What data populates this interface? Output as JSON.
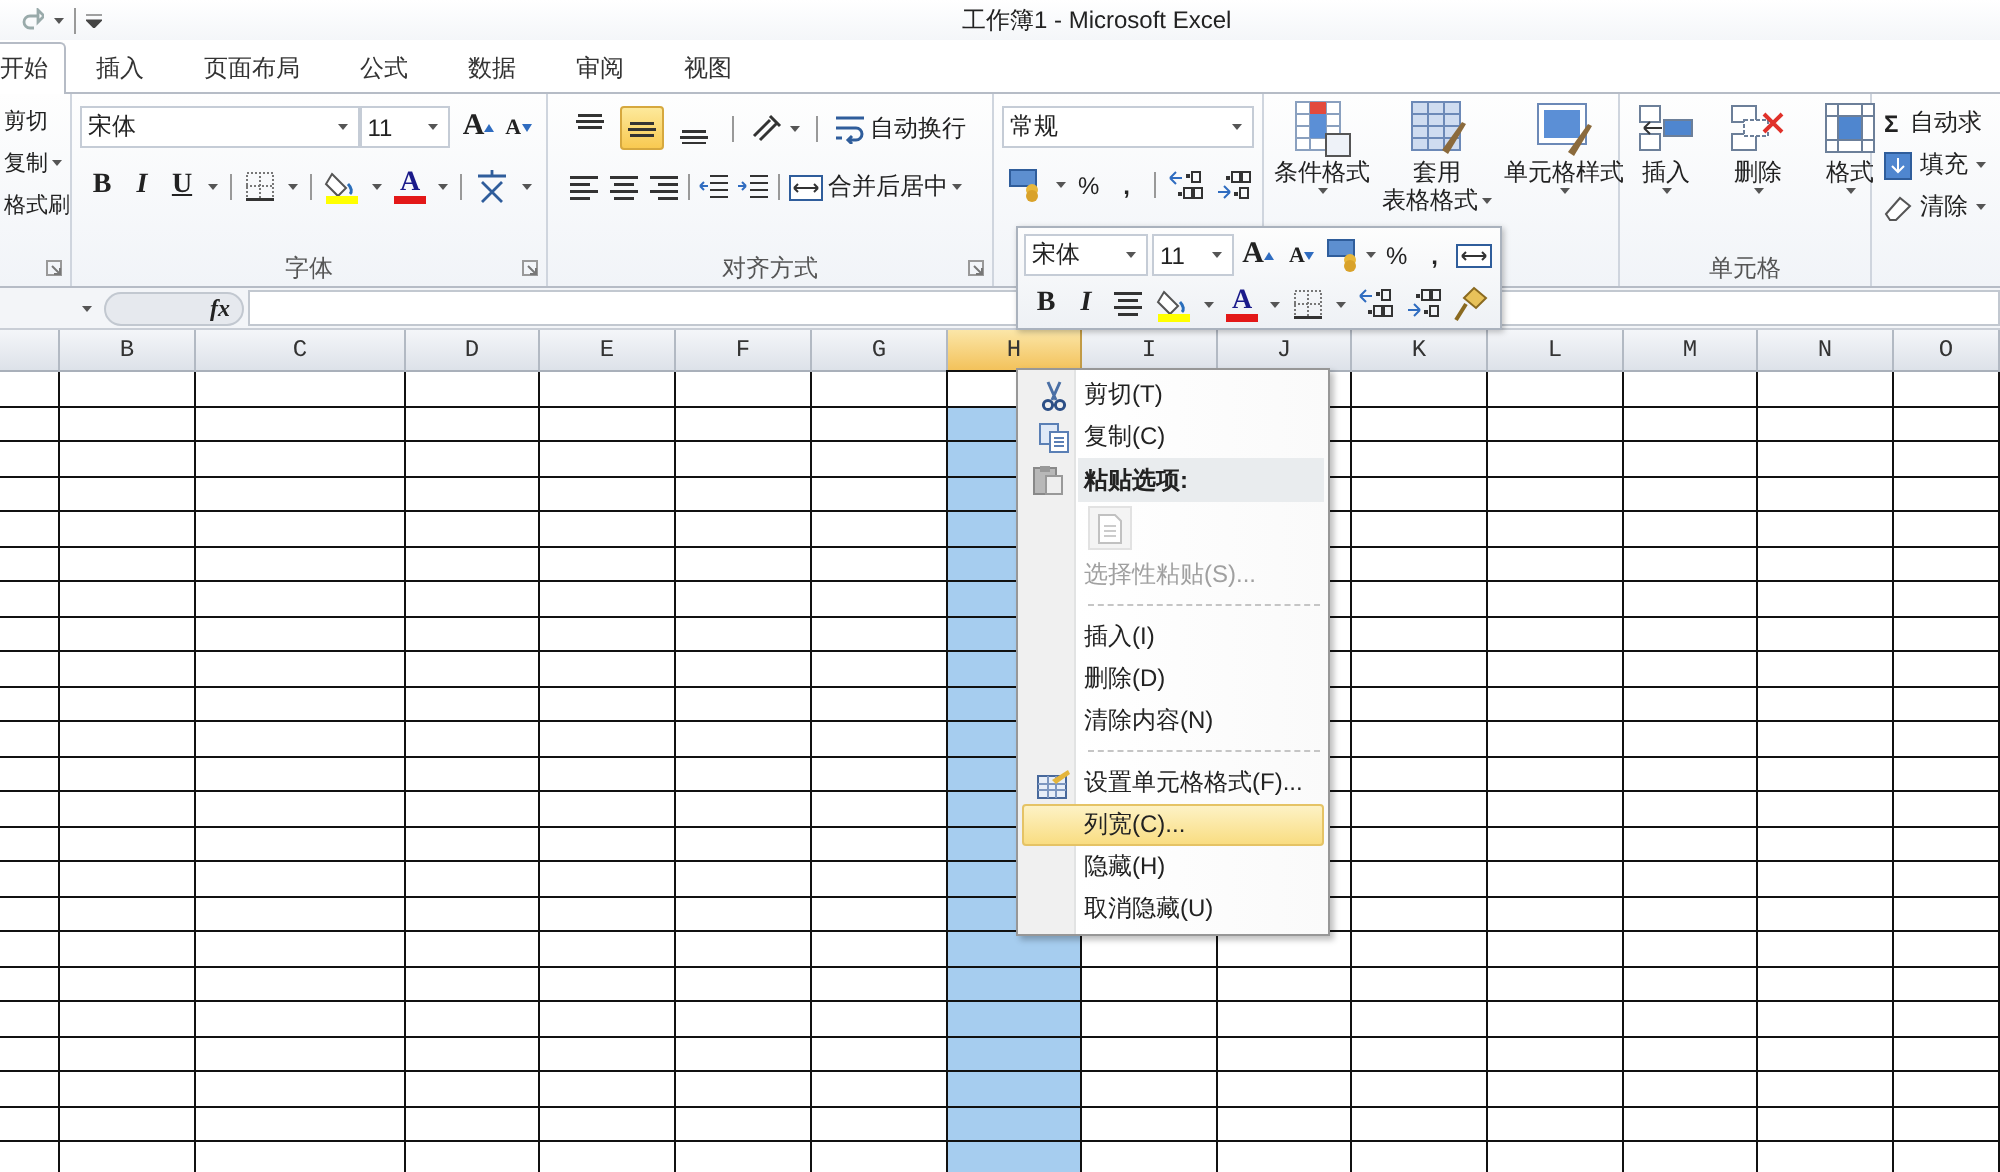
{
  "window": {
    "title": "工作簿1 - Microsoft Excel"
  },
  "tabs": [
    {
      "label": "开始",
      "selected": true
    },
    {
      "label": "插入",
      "selected": false
    },
    {
      "label": "页面布局",
      "selected": false
    },
    {
      "label": "公式",
      "selected": false
    },
    {
      "label": "数据",
      "selected": false
    },
    {
      "label": "审阅",
      "selected": false
    },
    {
      "label": "视图",
      "selected": false
    }
  ],
  "ribbon": {
    "clipboard": {
      "cut": "剪切",
      "copy": "复制",
      "format_painter": "格式刷"
    },
    "font": {
      "font_name": "宋体",
      "font_size": "11",
      "grow_font": "A",
      "shrink_font": "A",
      "bold": "B",
      "italic": "I",
      "underline": "U",
      "font_color": "A",
      "label": "字体"
    },
    "alignment": {
      "vertical_align": [
        {
          "selected": false
        },
        {
          "selected": true
        },
        {
          "selected": false
        }
      ],
      "wrap_text": "自动换行",
      "merge_center": "合并后居中",
      "label": "对齐方式"
    },
    "number": {
      "format": "常规",
      "percent": "%",
      "comma": ","
    },
    "styles": [
      {
        "lines": [
          "条件格式"
        ]
      },
      {
        "lines": [
          "套用",
          "表格格式"
        ]
      },
      {
        "lines": [
          "单元格样式"
        ]
      }
    ],
    "cells": {
      "buttons": [
        "插入",
        "删除",
        "格式"
      ],
      "label": "单元格"
    },
    "editing": {
      "autosum_symbol": "Σ",
      "autosum": "自动求",
      "fill": "填充",
      "clear": "清除"
    }
  },
  "formula_bar": {
    "function_label": "fx"
  },
  "sheet": {
    "columns": [
      {
        "selected": false
      },
      {
        "label": "B",
        "selected": false
      },
      {
        "label": "C",
        "selected": false
      },
      {
        "label": "D",
        "selected": false
      },
      {
        "label": "E",
        "selected": false
      },
      {
        "label": "F",
        "selected": false
      },
      {
        "label": "G",
        "selected": false
      },
      {
        "label": "H",
        "selected": true
      },
      {
        "label": "I",
        "selected": false
      },
      {
        "label": "J",
        "selected": false
      },
      {
        "label": "K",
        "selected": false
      },
      {
        "label": "L",
        "selected": false
      },
      {
        "label": "M",
        "selected": false
      },
      {
        "label": "N",
        "selected": false
      },
      {
        "label": "O",
        "selected": false
      }
    ]
  },
  "mini_toolbar": {
    "font_name": "宋体",
    "font_size": "11",
    "grow_font": "A",
    "shrink_font": "A",
    "percent": "%",
    "comma": ",",
    "bold": "B",
    "italic": "I",
    "font_color": "A"
  },
  "context_menu": {
    "items": [
      {
        "kind": "item",
        "label": "剪切(T)",
        "disabled": false,
        "selected": false
      },
      {
        "kind": "item",
        "label": "复制(C)",
        "disabled": false,
        "selected": false
      },
      {
        "kind": "header",
        "label": "粘贴选项:"
      },
      {
        "kind": "paste-option",
        "disabled": true
      },
      {
        "kind": "item",
        "label": "选择性粘贴(S)...",
        "disabled": true,
        "selected": false
      },
      {
        "kind": "separator"
      },
      {
        "kind": "item",
        "label": "插入(I)",
        "disabled": false,
        "selected": false
      },
      {
        "kind": "item",
        "label": "删除(D)",
        "disabled": false,
        "selected": false
      },
      {
        "kind": "item",
        "label": "清除内容(N)",
        "disabled": false,
        "selected": false
      },
      {
        "kind": "separator"
      },
      {
        "kind": "item",
        "label": "设置单元格格式(F)...",
        "disabled": false,
        "selected": false
      },
      {
        "kind": "item",
        "label": "列宽(C)...",
        "disabled": false,
        "selected": true
      },
      {
        "kind": "item",
        "label": "隐藏(H)",
        "disabled": false,
        "selected": false
      },
      {
        "kind": "item",
        "label": "取消隐藏(U)",
        "disabled": false,
        "selected": false
      }
    ]
  }
}
